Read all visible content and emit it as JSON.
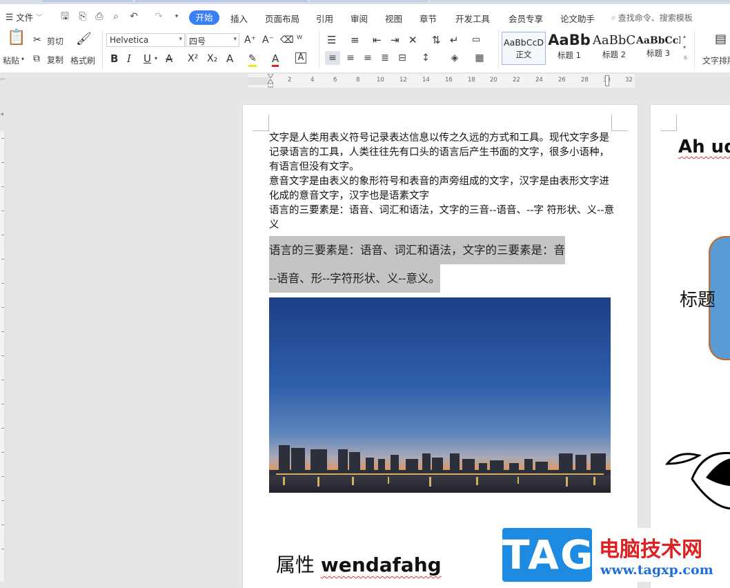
{
  "menubar": {
    "file_label": "文件",
    "tabs": [
      "开始",
      "插入",
      "页面布局",
      "引用",
      "审阅",
      "视图",
      "章节",
      "开发工具",
      "会员专享",
      "论文助手"
    ],
    "search_placeholder": "查找命令、搜索模板"
  },
  "ribbon": {
    "paste": "粘贴",
    "cut": "剪切",
    "copy": "复制",
    "format_painter": "格式刷",
    "font_name": "Helvetica",
    "font_size": "四号",
    "styles": [
      {
        "sample": "AaBbCcD",
        "label": "正文"
      },
      {
        "sample": "AaBb",
        "label": "标题 1"
      },
      {
        "sample": "AaBbC",
        "label": "标题 2"
      },
      {
        "sample": "AaBbCcI",
        "label": "标题 3"
      }
    ],
    "text_layout": "文字排版"
  },
  "ruler": {
    "numbers": [
      "2",
      "4",
      "6",
      "8",
      "10",
      "12",
      "14",
      "16",
      "18",
      "20",
      "22",
      "24",
      "26",
      "28",
      "30",
      "32"
    ]
  },
  "document": {
    "paragraphs": [
      "文字是人类用表义符号记录表达信息以传之久远的方式和工具。现代文字多是记录语言的工具，人类往往先有口头的语言后产生书面的文字，很多小语种，有语言但没有文字。",
      "意音文字是由表义的象形符号和表音的声旁组成的文字，汉字是由表形文字进化成的意音文字，汉字也是语素文字",
      "语言的三要素是：语音、词汇和语法，文字的三音--语音、--字  符形状、义--意义"
    ],
    "highlight_line1": "语言的三要素是：语音、词汇和语法，文字的三要素是：音",
    "highlight_line2": "--语音、形--字符形状、义--意义。",
    "attribute_zh": "属性 ",
    "attribute_en": "wendafahg"
  },
  "page2": {
    "title": "Ah ud",
    "heading": "标题"
  },
  "watermark": {
    "tag": "TAG",
    "cn": "电脑技术网",
    "url": "www.tagxp.com"
  },
  "colors": {
    "accent": "#3a7ff6",
    "highlight": "#c4c4c4",
    "watermark_blue": "#1d8be2",
    "watermark_red": "#e02020"
  }
}
